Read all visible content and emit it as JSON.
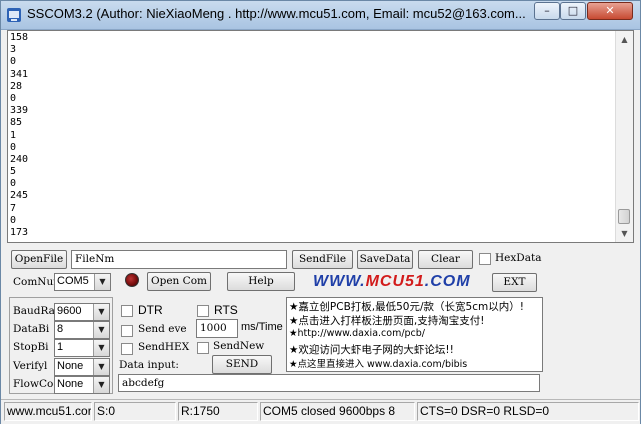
{
  "window": {
    "title": "SSCOM3.2 (Author: NieXiaoMeng .  http://www.mcu51.com,  Email: mcu52@163.com...",
    "minimize": "–",
    "maximize": "□",
    "close": "✕"
  },
  "receive_lines": [
    "158",
    "3",
    "0",
    "341",
    "28",
    "0",
    "339",
    "85",
    "1",
    "0",
    "240",
    "5",
    "0",
    "245",
    "7",
    "0",
    "173"
  ],
  "row1": {
    "open_file": "OpenFile",
    "file_name": "FileNm",
    "send_file": "SendFile",
    "save_data": "SaveData",
    "clear": "Clear",
    "hex_data": "HexData"
  },
  "row2": {
    "com_num_label": "ComNum",
    "com_port": "COM5",
    "open_com": "Open Com",
    "help": "Help",
    "logo_left": "WWW.",
    "logo_mid": "MCU51",
    "logo_right": ".COM",
    "exit": "EXT"
  },
  "settings": {
    "baud_label": "BaudRa",
    "baud_value": "9600",
    "databits_label": "DataBi",
    "databits_value": "8",
    "stopbits_label": "StopBi",
    "stopbits_value": "1",
    "verify_label": "Verifyl",
    "verify_value": "None",
    "flow_label": "FlowCo",
    "flow_value": "None"
  },
  "options": {
    "dtr": "DTR",
    "rts": "RTS",
    "send_every": "Send eve",
    "interval_value": "1000",
    "interval_unit": "ms/Time",
    "send_hex": "SendHEX",
    "send_new": "SendNew",
    "data_input_label": "Data input:",
    "send_button": "SEND",
    "data_input_value": "abcdefg"
  },
  "ad_lines": [
    "★嘉立创PCB打板,最低50元/款（长宽5cm以内）!",
    "★点击进入打样板注册页面,支持淘宝支付!",
    "★http://www.daxia.com/pcb/",
    "★欢迎访问大虾电子网的大虾论坛!!",
    "★点这里直接进入 www.daxia.com/bibis"
  ],
  "statusbar": {
    "site": "www.mcu51.cor",
    "sent": "S:0",
    "received": "R:1750",
    "port_state": "COM5 closed  9600bps  8",
    "lines": "CTS=0 DSR=0 RLSD=0"
  }
}
